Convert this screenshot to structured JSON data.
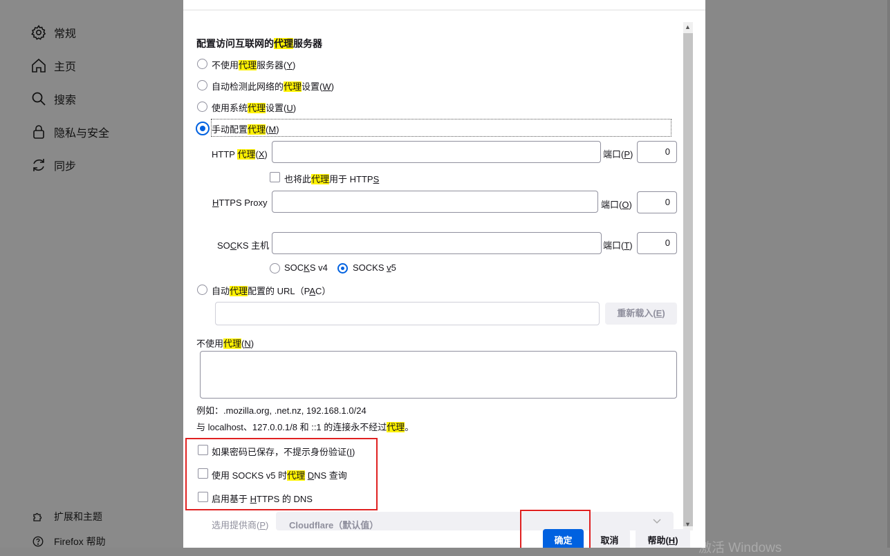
{
  "sidebar": {
    "items": [
      {
        "label": "常规",
        "icon": "gear-icon"
      },
      {
        "label": "主页",
        "icon": "home-icon"
      },
      {
        "label": "搜索",
        "icon": "search-icon"
      },
      {
        "label": "隐私与安全",
        "icon": "lock-icon"
      },
      {
        "label": "同步",
        "icon": "sync-icon"
      }
    ],
    "footer": [
      {
        "label": "扩展和主题",
        "icon": "puzzle-icon"
      },
      {
        "label": "Firefox 帮助",
        "icon": "help-icon"
      }
    ]
  },
  "dialog": {
    "heading_pre": "配置访问互联网的",
    "heading_hl": "代理",
    "heading_post": "服务器",
    "radio_none": {
      "pre": "不使用",
      "hl": "代理",
      "post": "服务器(",
      "key": "Y",
      "end": ")"
    },
    "radio_auto_detect": {
      "pre": "自动检测此网络的",
      "hl": "代理",
      "post": "设置(",
      "key": "W",
      "end": ")"
    },
    "radio_system": {
      "pre": "使用系统",
      "hl": "代理",
      "post": "设置(",
      "key": "U",
      "end": ")"
    },
    "radio_manual": {
      "pre": "手动配置",
      "hl": "代理",
      "post": "(",
      "key": "M",
      "end": ")"
    },
    "http": {
      "pre": "HTTP ",
      "hl": "代理",
      "post": "(",
      "key": "X",
      "end": ")",
      "value": ""
    },
    "http_port": {
      "label_pre": "端口(",
      "key": "P",
      "end": ")",
      "value": "0"
    },
    "also_https": {
      "pre": "也将此",
      "hl": "代理",
      "post": "用于 HTTP",
      "key": "S"
    },
    "https": {
      "key": "H",
      "post": "TTPS Proxy",
      "value": ""
    },
    "https_port": {
      "label_pre": "端口(",
      "key": "O",
      "end": ")",
      "value": "0"
    },
    "socks": {
      "pre": "SO",
      "key": "C",
      "post": "KS 主机",
      "value": ""
    },
    "socks_port": {
      "label_pre": "端口(",
      "key": "T",
      "end": ")",
      "value": "0"
    },
    "socks_v4": {
      "pre": "SOC",
      "key": "K",
      "post": "S v4"
    },
    "socks_v5": {
      "pre": "SOCKS ",
      "key": "v",
      "post": "5"
    },
    "pac": {
      "pre": "自动",
      "hl": "代理",
      "post": "配置的 URL（P",
      "key": "A",
      "end": "C）",
      "value": ""
    },
    "reload_button": {
      "pre": "重新载入(",
      "key": "E",
      "end": ")"
    },
    "no_proxy": {
      "pre": "不使用",
      "hl": "代理",
      "post": "(",
      "key": "N",
      "end": ")",
      "value": ""
    },
    "example": "例如：.mozilla.org, .net.nz, 192.168.1.0/24",
    "localhost_note": {
      "pre": "与 localhost、127.0.0.1/8 和 ::1 的连接永不经过",
      "hl": "代理",
      "post": "。"
    },
    "no_auth_prompt": {
      "pre": "如果密码已保存，不提示身份验证(",
      "key": "I",
      "end": ")"
    },
    "socks_dns": {
      "pre": "使用 SOCKS v5 时",
      "hl": "代理",
      "mid": " ",
      "key": "D",
      "post": "NS 查询"
    },
    "doh": {
      "pre": "启用基于 ",
      "key": "H",
      "post": "TTPS 的 DNS"
    },
    "provider": {
      "pre": "选用提供商(",
      "key": "P",
      "end": ")",
      "value": "Cloudflare（默认值）"
    },
    "ok_button": "确定",
    "cancel_button": "取消",
    "help_button": {
      "pre": "帮助(",
      "key": "H",
      "end": ")"
    }
  },
  "watermark": "激活 Windows",
  "colors": {
    "accent": "#0061e0",
    "highlight": "#fff200",
    "annotation": "#e02020"
  }
}
